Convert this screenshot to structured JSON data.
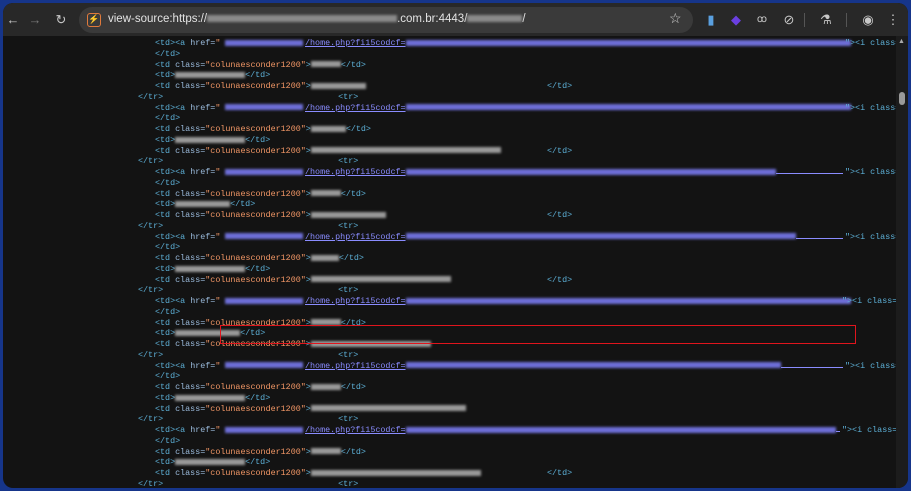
{
  "browser": {
    "url_prefix": "view-source:https://",
    "url_mid": ".com.br:4443/",
    "url_suffix": "/",
    "icons": [
      "back-icon",
      "forward-icon",
      "reload-icon",
      "site-icon",
      "bookmark-star-icon",
      "extension-1-icon",
      "extension-2-icon",
      "extension-3-icon",
      "extension-4-icon",
      "labs-flask-icon",
      "profile-icon",
      "menu-icon"
    ]
  },
  "source": {
    "td_open": "<td>",
    "a_open": "<a ",
    "href_attr": "href=",
    "path": "/home.php?fi15codcf=",
    "td_close": "</td>",
    "td_class_open": "<td ",
    "class_attr": "class=",
    "class_value": "\"colunaesconder1200\"",
    "gt": ">",
    "tr_close": "</tr>",
    "tr_open": "<tr>",
    "i_tail": "\"><i class=\"",
    "quote": "\""
  },
  "colors": {
    "highlight": "#e0151d",
    "frame": "#16358a"
  },
  "highlighted_row": 5,
  "row_count": 7
}
